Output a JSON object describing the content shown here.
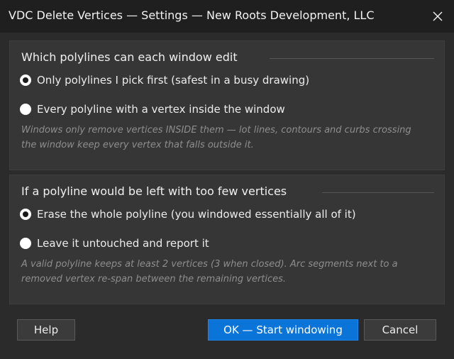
{
  "window": {
    "title": "VDC Delete Vertices — Settings — New Roots Development, LLC",
    "close_icon": "close-icon"
  },
  "group_edit": {
    "heading": "Which polylines can each window edit",
    "options": [
      {
        "label": "Only polylines I pick first (safest in a busy drawing)",
        "selected": true
      },
      {
        "label": "Every polyline with a vertex inside the window",
        "selected": false
      }
    ],
    "note": "Windows only remove vertices INSIDE them — lot lines, contours and curbs crossing the window keep every vertex that falls outside it."
  },
  "group_few": {
    "heading": "If a polyline would be left with too few vertices",
    "options": [
      {
        "label": "Erase the whole polyline (you windowed essentially all of it)",
        "selected": true
      },
      {
        "label": "Leave it untouched and report it",
        "selected": false
      }
    ],
    "note": "A valid polyline keeps at least 2 vertices (3 when closed). Arc segments next to a removed vertex re-span between the remaining vertices."
  },
  "buttons": {
    "help": "Help",
    "ok": "OK — Start windowing",
    "cancel": "Cancel"
  },
  "colors": {
    "background": "#2b2b2b",
    "titlebar": "#1f1f1f",
    "group": "#363636",
    "accent": "#0a74d9",
    "note_text": "#8e8e8e"
  }
}
